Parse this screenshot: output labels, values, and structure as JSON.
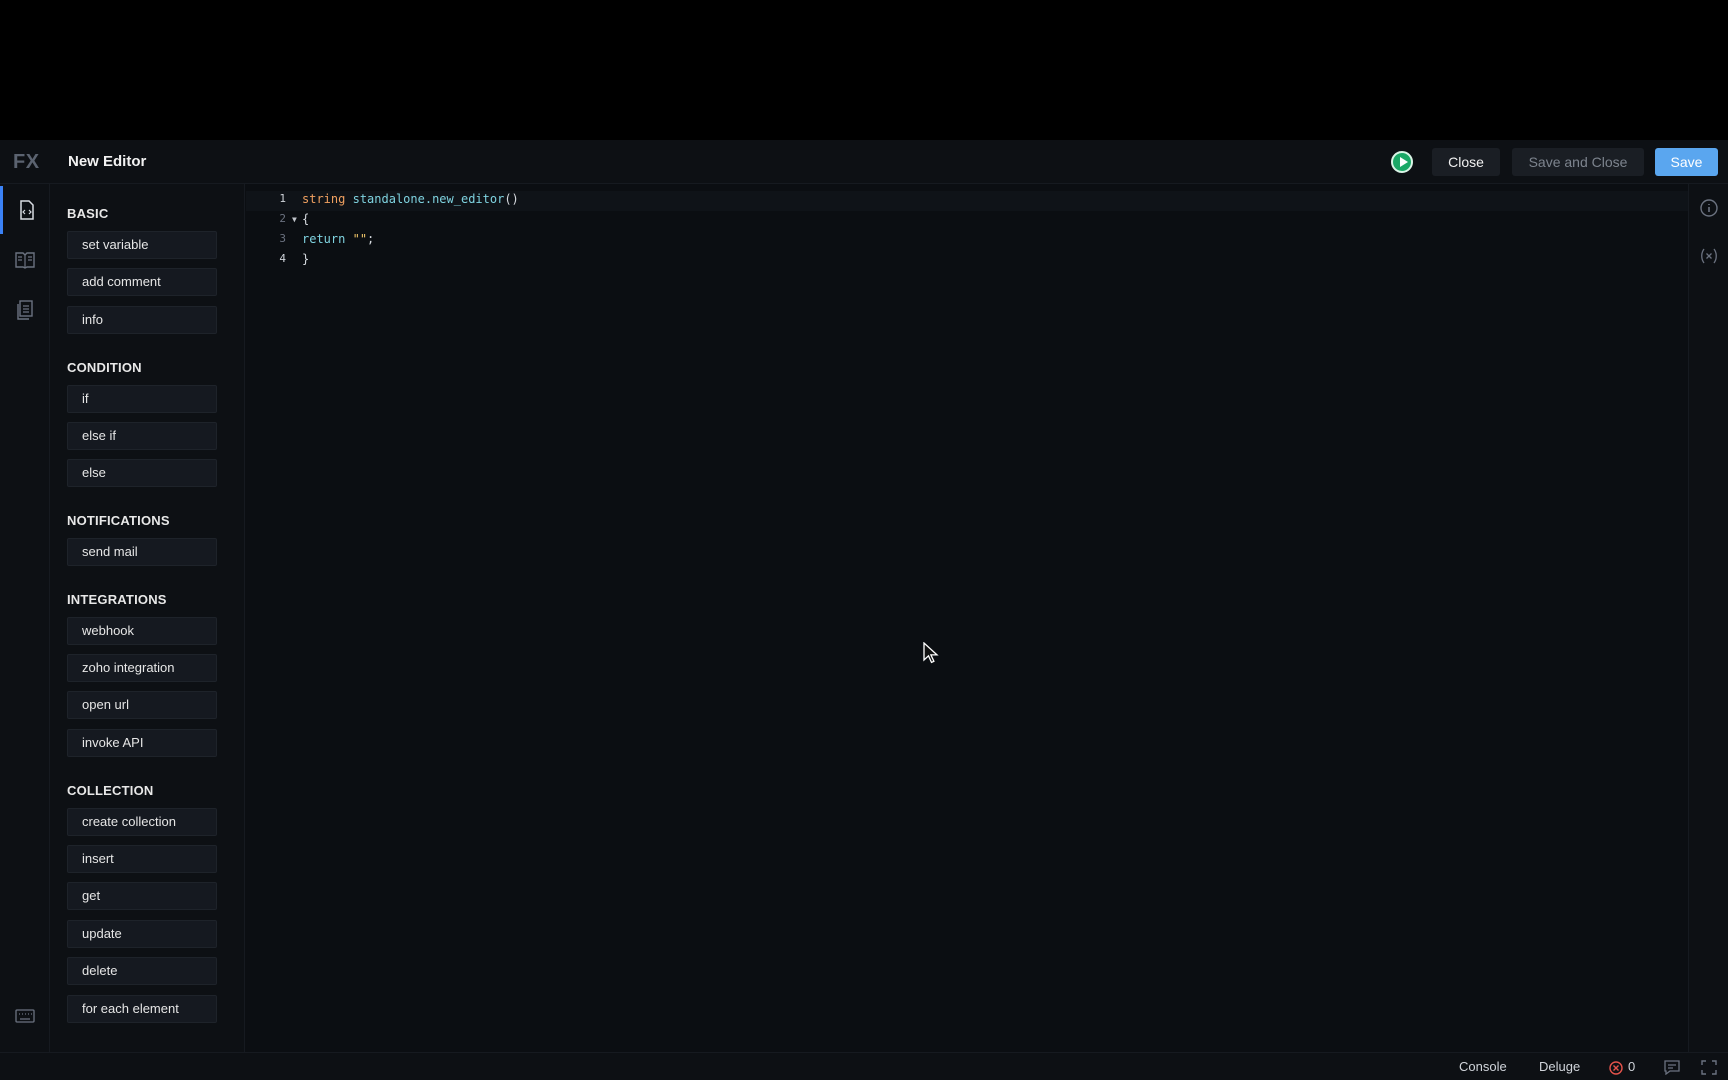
{
  "header": {
    "logo": "FX",
    "title": "New Editor",
    "close_label": "Close",
    "save_and_close_label": "Save and Close",
    "save_label": "Save",
    "run_icon": "play-circle-icon"
  },
  "rail": {
    "items": [
      {
        "icon": "code-file-icon",
        "active": true
      },
      {
        "icon": "book-icon",
        "active": false
      },
      {
        "icon": "document-list-icon",
        "active": false
      }
    ],
    "bottom_icons": [
      "keyboard-icon",
      "gear-icon"
    ]
  },
  "palette": {
    "sections": [
      {
        "title": "BASIC",
        "items": [
          "set variable",
          "add comment",
          "info"
        ]
      },
      {
        "title": "CONDITION",
        "items": [
          "if",
          "else if",
          "else"
        ]
      },
      {
        "title": "NOTIFICATIONS",
        "items": [
          "send mail"
        ]
      },
      {
        "title": "INTEGRATIONS",
        "items": [
          "webhook",
          "zoho integration",
          "open url",
          "invoke API"
        ]
      },
      {
        "title": "COLLECTION",
        "items": [
          "create collection",
          "insert",
          "get",
          "update",
          "delete",
          "for each element"
        ]
      }
    ]
  },
  "editor": {
    "lines": [
      {
        "num": "1",
        "tokens": [
          {
            "t": "string",
            "c": "kw"
          },
          {
            "t": " ",
            "c": ""
          },
          {
            "t": "standalone.new_editor",
            "c": "fn"
          },
          {
            "t": "()",
            "c": ""
          }
        ]
      },
      {
        "num": "2",
        "tokens": [
          {
            "t": "{",
            "c": ""
          }
        ]
      },
      {
        "num": "3",
        "tokens": [
          {
            "t": "return",
            "c": "fn"
          },
          {
            "t": " ",
            "c": ""
          },
          {
            "t": "\"\"",
            "c": "str"
          },
          {
            "t": ";",
            "c": ""
          }
        ]
      },
      {
        "num": "4",
        "tokens": [
          {
            "t": "}",
            "c": ""
          }
        ]
      }
    ]
  },
  "right_rail": {
    "icons": [
      "info-icon",
      "variable-x-icon"
    ]
  },
  "footer": {
    "console_label": "Console",
    "language_label": "Deluge",
    "error_count": "0",
    "icons": [
      "error-icon",
      "feedback-icon",
      "fullscreen-icon"
    ]
  },
  "colors": {
    "accent": "#5aa6ef",
    "run_green": "#1aa866",
    "error_red": "#e5534b"
  }
}
